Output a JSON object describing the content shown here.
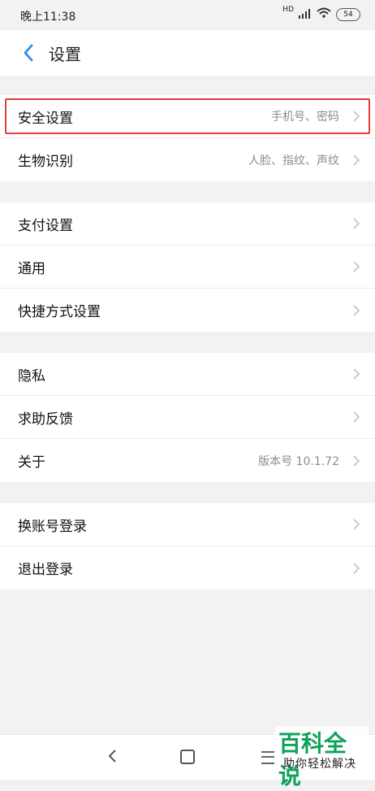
{
  "status_bar": {
    "time": "晚上11:38",
    "hd_label": "HD",
    "battery": "54"
  },
  "header": {
    "title": "设置"
  },
  "groups": [
    {
      "items": [
        {
          "label": "安全设置",
          "value": "手机号、密码",
          "highlighted": true
        },
        {
          "label": "生物识别",
          "value": "人脸、指纹、声纹"
        }
      ]
    },
    {
      "items": [
        {
          "label": "支付设置",
          "value": ""
        },
        {
          "label": "通用",
          "value": ""
        },
        {
          "label": "快捷方式设置",
          "value": ""
        }
      ]
    },
    {
      "items": [
        {
          "label": "隐私",
          "value": ""
        },
        {
          "label": "求助反馈",
          "value": ""
        },
        {
          "label": "关于",
          "value": "版本号 10.1.72"
        }
      ]
    },
    {
      "items": [
        {
          "label": "换账号登录",
          "value": ""
        },
        {
          "label": "退出登录",
          "value": ""
        }
      ]
    }
  ],
  "watermark": {
    "main": "百科全说",
    "sub": "助你轻松解决"
  },
  "colors": {
    "highlight": "#e53d3d",
    "accent": "#2f8cf0",
    "watermark_green": "#11a15a"
  },
  "icons": {
    "back": "chevron-left-icon",
    "row_chevron": "chevron-right-icon"
  }
}
